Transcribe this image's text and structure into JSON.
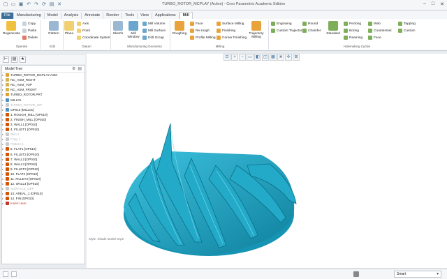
{
  "window": {
    "title": "TURBO_ROTOR_MCPLAY (Active) - Creo Parametric Academic Edition"
  },
  "tabs": [
    "File",
    "Manufacturing",
    "Model",
    "Analysis",
    "Annotate",
    "Render",
    "Tools",
    "View",
    "Applications",
    "Mill"
  ],
  "ribbon": {
    "operate": {
      "label": "Operate",
      "regenerate": "Regenerate"
    },
    "edit": {
      "label": "Edit",
      "copy": "Copy",
      "paste": "Paste",
      "delete": "Delete",
      "pattern": "Pattern"
    },
    "datum": {
      "label": "Datum",
      "plane": "Plane",
      "axis": "Axis",
      "point": "Point",
      "csys": "Coordinate System"
    },
    "geometry": {
      "label": "Manufacturing Geometry",
      "sketch": "Sketch",
      "mill_window": "Mill Window",
      "mill_volume": "Mill Volume",
      "mill_surface": "Mill Surface",
      "drill_group": "Drill Group"
    },
    "milling": {
      "label": "Milling",
      "roughing": "Roughing",
      "face": "Face",
      "rerough": "Re-rough",
      "profile_milling": "Profile Milling",
      "surface_milling": "Surface Milling",
      "finishing": "Finishing",
      "corner_finishing": "Corner Finishing",
      "trajectory_milling": "Trajectory Milling"
    },
    "holemaking": {
      "label": "Holemaking Cycles",
      "engraving": "Engraving",
      "custom_trajectory": "Custom Trajectory",
      "round": "Round",
      "chamfer": "Chamfer",
      "standard": "Standard",
      "pecking": "Pecking",
      "boring": "Boring",
      "reaming": "Reaming",
      "web": "Web",
      "countersink": "Countersink",
      "facing": "Face",
      "tapping": "Tapping",
      "custom": "Custom"
    }
  },
  "model_tree": {
    "header": "Model Tree",
    "items": [
      {
        "label": "TURBO_ROTOR_MCPLAY.ASM",
        "state": "normal",
        "color": "#e0a030"
      },
      {
        "label": "NC_ASM_RIGHT",
        "state": "normal",
        "color": "#d4b24c"
      },
      {
        "label": "NC_ASM_TOP",
        "state": "normal",
        "color": "#d4b24c"
      },
      {
        "label": "NC_ASM_FRONT",
        "state": "normal",
        "color": "#d4b24c"
      },
      {
        "label": "TURBO_ROTOR.PRT",
        "state": "normal",
        "color": "#e0a030"
      },
      {
        "label": "MILL01",
        "state": "normal",
        "color": "#4a90c0"
      },
      {
        "label": "TURBO_ROTOR_WP",
        "state": "dim",
        "color": "#c8c8c8"
      },
      {
        "label": "OP010 [MILL01]",
        "state": "normal",
        "color": "#4a90c0"
      },
      {
        "label": "1. ROUGH_MILL [OP010]",
        "state": "normal",
        "color": "#d35400"
      },
      {
        "label": "2. FINISH_MILL [OP010]",
        "state": "normal",
        "color": "#d35400"
      },
      {
        "label": "3. WALL1 [OP010]",
        "state": "normal",
        "color": "#d35400"
      },
      {
        "label": "4. FILLET1 [OP010]",
        "state": "normal",
        "color": "#d35400"
      },
      {
        "label": "Skin 1",
        "state": "dim",
        "color": "#c8c8c8"
      },
      {
        "label": "Copy 1",
        "state": "dim",
        "color": "#c8c8c8"
      },
      {
        "label": "Pattern 1",
        "state": "dim",
        "color": "#c8c8c8"
      },
      {
        "label": "5. FLAT1 [OP010]",
        "state": "normal",
        "color": "#d35400"
      },
      {
        "label": "6. FILLET2 [OP010]",
        "state": "normal",
        "color": "#d35400"
      },
      {
        "label": "7. WALL2 [OP010]",
        "state": "normal",
        "color": "#d35400"
      },
      {
        "label": "8. WALL3 [OP010]",
        "state": "normal",
        "color": "#d35400"
      },
      {
        "label": "9. FILLET3 [OP010]",
        "state": "normal",
        "color": "#d35400"
      },
      {
        "label": "10. FLAT2 [OP010]",
        "state": "normal",
        "color": "#d35400"
      },
      {
        "label": "11. FILLET4 [OP010]",
        "state": "normal",
        "color": "#d35400"
      },
      {
        "label": "12. WALL4 [OP010]",
        "state": "normal",
        "color": "#d35400"
      },
      {
        "label": "SURFACE_DEF",
        "state": "dim",
        "color": "#c8c8c8"
      },
      {
        "label": "13. AREAL_1 [OP010]",
        "state": "normal",
        "color": "#d35400"
      },
      {
        "label": "14. FIN [OP010]",
        "state": "normal",
        "color": "#d35400"
      },
      {
        "label": "Insert Here",
        "state": "insert",
        "color": "#c0392b"
      }
    ]
  },
  "viewport": {
    "style_label": "Style: Shade Model Style",
    "model_color": "#1aa3c2"
  },
  "status": {
    "filter_value": "Smart"
  }
}
